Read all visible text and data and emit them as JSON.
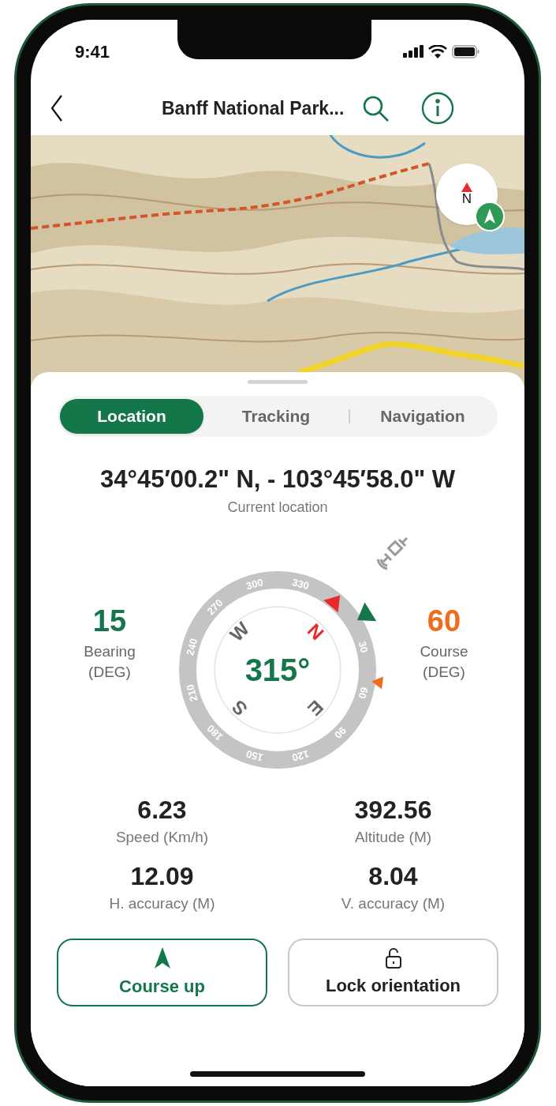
{
  "status_bar": {
    "time": "9:41"
  },
  "header": {
    "title": "Banff National Park..."
  },
  "map": {
    "compass": {
      "label": "N"
    }
  },
  "tabs": [
    {
      "label": "Location",
      "selected": true
    },
    {
      "label": "Tracking",
      "selected": false
    },
    {
      "label": "Navigation",
      "selected": false
    }
  ],
  "location": {
    "coordinates": "34°45′00.2\" N, - 103°45′58.0\" W",
    "caption": "Current location"
  },
  "compass": {
    "heading": "315°",
    "dial_labels": [
      "30",
      "60",
      "90",
      "120",
      "150",
      "180",
      "210",
      "240",
      "270",
      "300",
      "330"
    ],
    "cardinals": [
      "N",
      "E",
      "S",
      "W"
    ]
  },
  "readouts": [
    {
      "value": "15",
      "label": "Bearing",
      "unit": "(DEG)",
      "color": "#13774a"
    },
    {
      "value": "60",
      "label": "Course",
      "unit": "(DEG)",
      "color": "#f26a1b"
    }
  ],
  "stats": [
    {
      "value": "6.23",
      "label": "Speed (Km/h)"
    },
    {
      "value": "392.56",
      "label": "Altitude (M)"
    },
    {
      "value": "12.09",
      "label": "H. accuracy (M)"
    },
    {
      "value": "8.04",
      "label": "V. accuracy (M)"
    }
  ],
  "buttons": [
    {
      "label": "Course up",
      "kind": "course",
      "selected": true
    },
    {
      "label": "Lock orientation",
      "kind": "lock",
      "selected": false
    }
  ]
}
